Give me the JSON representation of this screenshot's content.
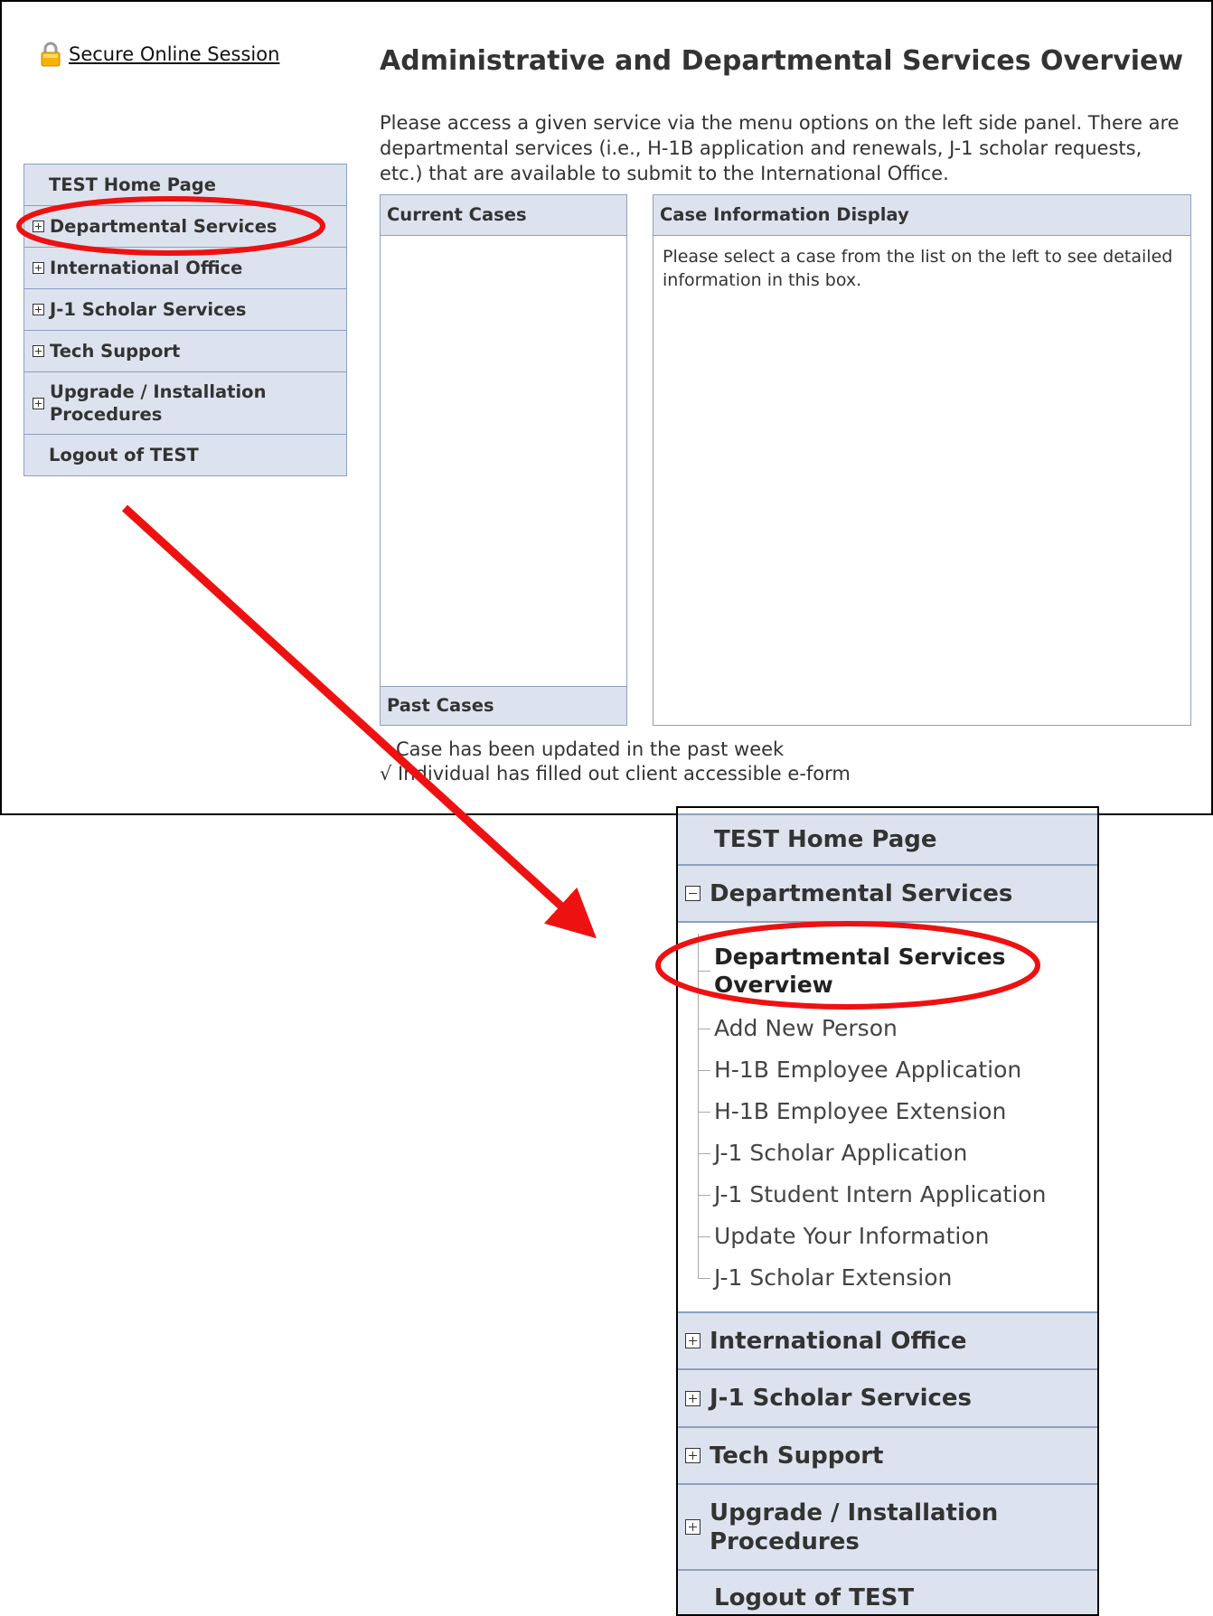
{
  "top": {
    "secure_session": "Secure Online Session",
    "title": "Administrative and Departmental Services Overview",
    "intro": "Please access a given service via the menu options on the left side panel. There are departmental services (i.e., H-1B application and renewals, J-1 scholar requests, etc.) that are available to submit to the International Office.",
    "nav": {
      "home": "TEST Home Page",
      "departmental": "Departmental Services",
      "international": "International Office",
      "j1": "J-1 Scholar Services",
      "tech": "Tech Support",
      "upgrade": "Upgrade / Installation Procedures",
      "logout": "Logout of TEST"
    },
    "current_cases": "Current Cases",
    "past_cases": "Past Cases",
    "case_info_title": "Case Information Display",
    "case_info_msg": "Please select a case from the list on the left to see detailed information in this box.",
    "legend_updated": "Case has been updated in the past week",
    "legend_eform": "√ Individual has filled out client accessible e-form"
  },
  "zoom": {
    "nav": {
      "home": "TEST Home Page",
      "departmental": "Departmental Services",
      "international": "International Office",
      "j1": "J-1 Scholar Services",
      "tech": "Tech Support",
      "upgrade": "Upgrade / Installation Procedures",
      "logout": "Logout of TEST"
    },
    "sub_items": [
      "Departmental Services Overview",
      "Add New Person",
      "H-1B Employee Application",
      "H-1B Employee Extension",
      "J-1 Scholar Application",
      "J-1 Student Intern Application",
      "Update Your Information",
      "J-1 Scholar Extension"
    ]
  },
  "annotation_color": "#ee1111"
}
